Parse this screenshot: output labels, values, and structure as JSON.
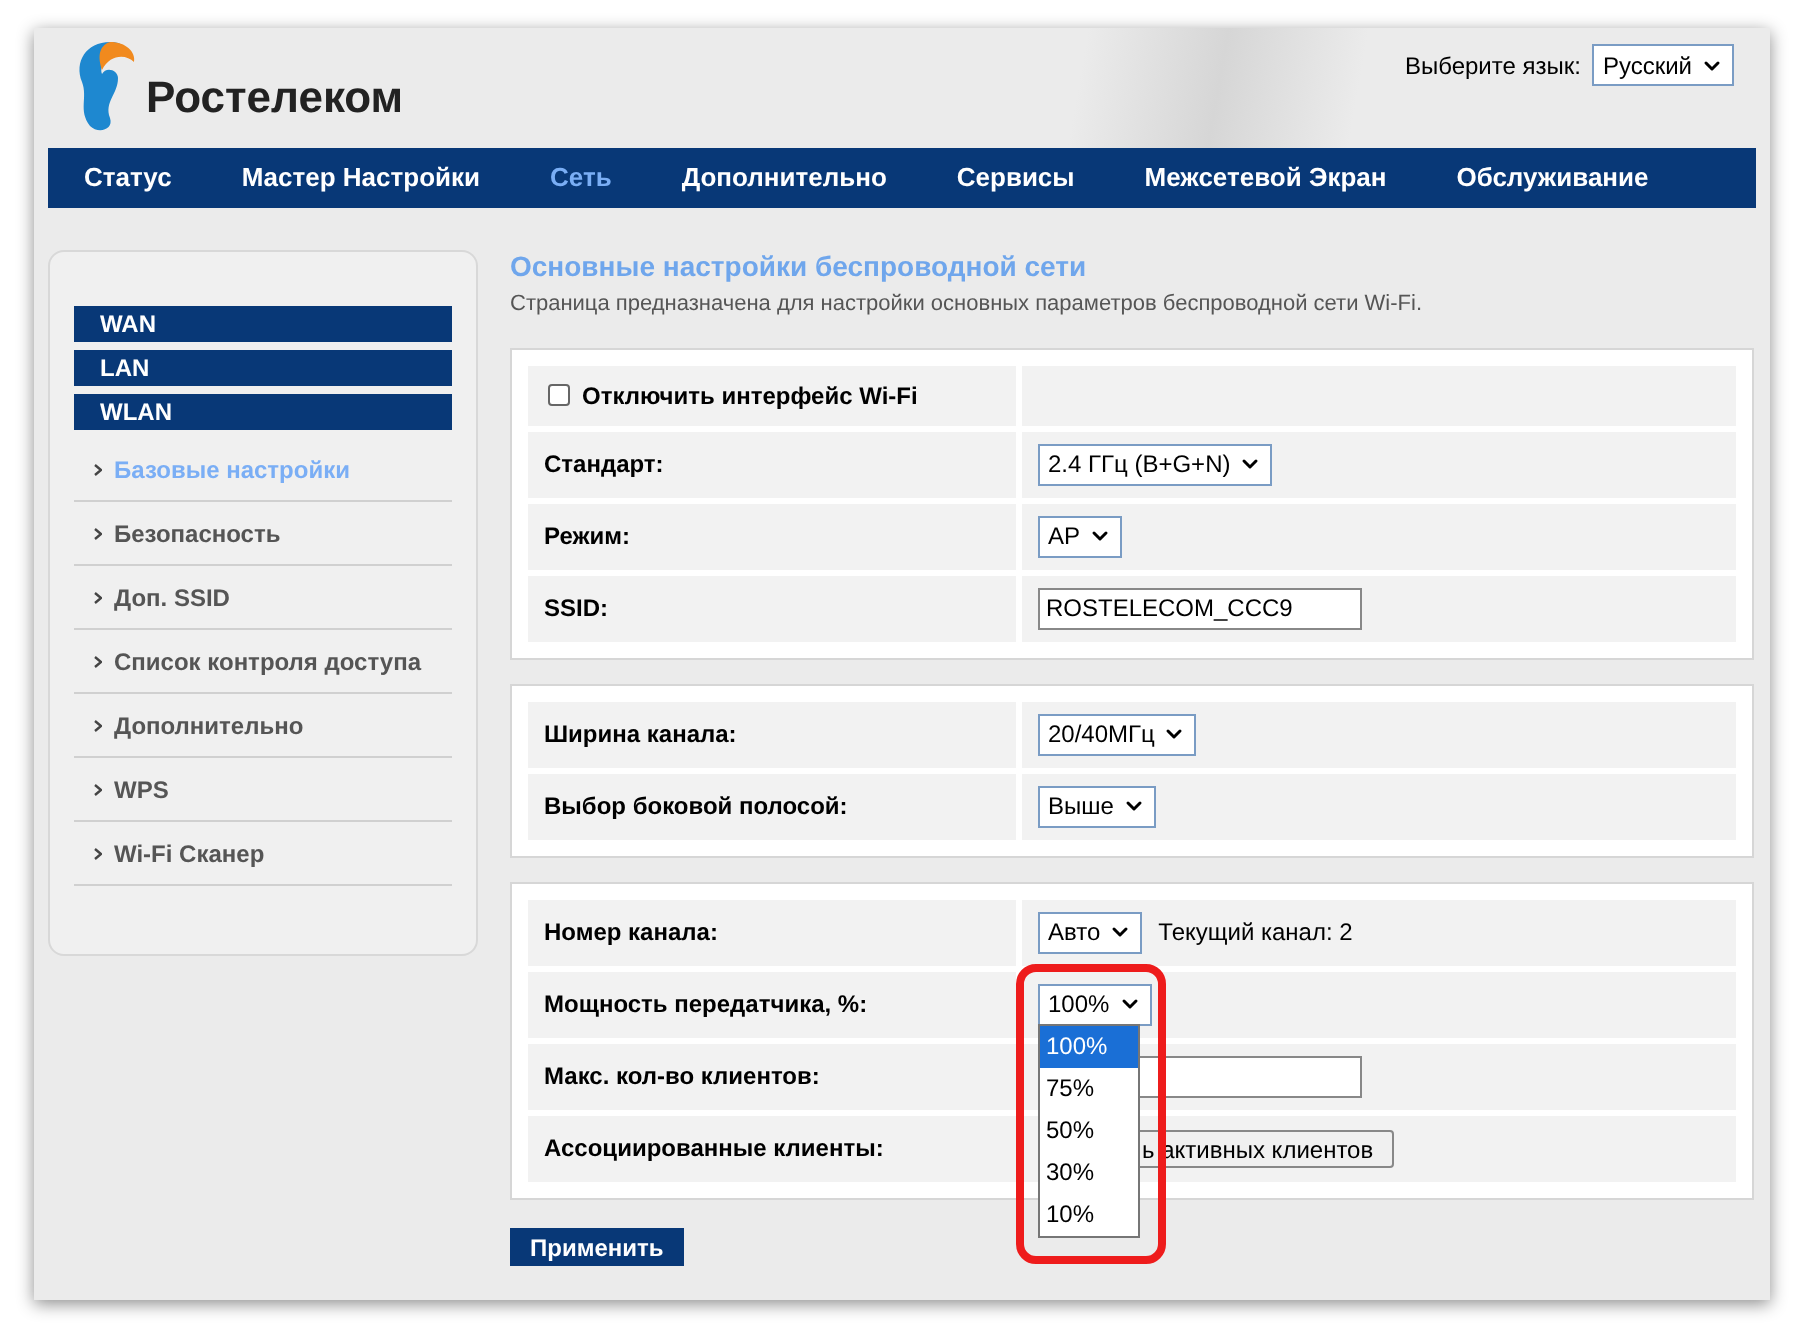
{
  "logo": {
    "text": "Ростелеком"
  },
  "language": {
    "label": "Выберите язык:",
    "value": "Русский"
  },
  "nav": [
    {
      "label": "Статус",
      "selected": false
    },
    {
      "label": "Мастер Настройки",
      "selected": false
    },
    {
      "label": "Сеть",
      "selected": true
    },
    {
      "label": "Дополнительно",
      "selected": false
    },
    {
      "label": "Сервисы",
      "selected": false
    },
    {
      "label": "Межсетевой Экран",
      "selected": false
    },
    {
      "label": "Обслуживание",
      "selected": false
    }
  ],
  "sidebar": {
    "groups": [
      {
        "label": "WAN"
      },
      {
        "label": "LAN"
      },
      {
        "label": "WLAN",
        "items": [
          {
            "label": "Базовые настройки",
            "selected": true
          },
          {
            "label": "Безопасность",
            "selected": false
          },
          {
            "label": "Доп. SSID",
            "selected": false
          },
          {
            "label": "Список контроля доступа",
            "selected": false
          },
          {
            "label": "Дополнительно",
            "selected": false
          },
          {
            "label": "WPS",
            "selected": false
          },
          {
            "label": "Wi-Fi Сканер",
            "selected": false
          }
        ]
      }
    ]
  },
  "page": {
    "title": "Основные настройки беспроводной сети",
    "description": "Страница предназначена для настройки основных параметров беспроводной сети Wi-Fi."
  },
  "sections": [
    {
      "rows": [
        {
          "kind": "checkbox",
          "label": "Отключить интерфейс Wi-Fi",
          "checked": false
        },
        {
          "kind": "select",
          "label": "Стандарт:",
          "value": "2.4 ГГц (B+G+N)"
        },
        {
          "kind": "select",
          "label": "Режим:",
          "value": "AP"
        },
        {
          "kind": "input",
          "label": "SSID:",
          "value": "ROSTELECOM_CCC9"
        }
      ]
    },
    {
      "rows": [
        {
          "kind": "select",
          "label": "Ширина канала:",
          "value": "20/40МГц"
        },
        {
          "kind": "select",
          "label": "Выбор боковой полосой:",
          "value": "Выше"
        }
      ]
    },
    {
      "rows": [
        {
          "kind": "select",
          "label": "Номер канала:",
          "value": "Авто",
          "note": "Текущий канал: 2"
        },
        {
          "kind": "select",
          "label": "Мощность передатчика, %:",
          "value": "100%",
          "expanded": true,
          "options": [
            {
              "label": "100%",
              "selected": true
            },
            {
              "label": "75%",
              "selected": false
            },
            {
              "label": "50%",
              "selected": false
            },
            {
              "label": "30%",
              "selected": false
            },
            {
              "label": "10%",
              "selected": false
            }
          ]
        },
        {
          "kind": "input",
          "label": "Макс. кол-во клиентов:"
        },
        {
          "kind": "button",
          "label": "Ассоциированные клиенты:",
          "button": "ь активных клиентов"
        }
      ]
    }
  ],
  "apply_button": "Применить"
}
